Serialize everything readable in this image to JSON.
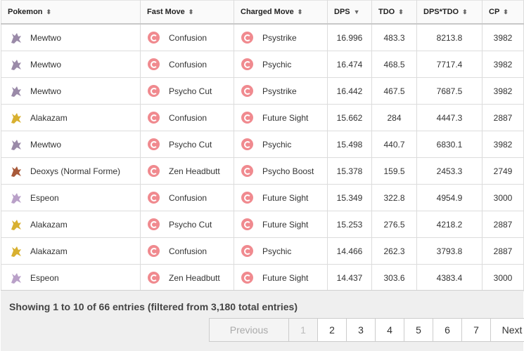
{
  "headers": {
    "pokemon": "Pokemon",
    "fast_move": "Fast Move",
    "charged_move": "Charged Move",
    "dps": "DPS",
    "tdo": "TDO",
    "dps_tdo": "DPS*TDO",
    "cp": "CP"
  },
  "sort_icons": {
    "unsorted": "⬍",
    "desc": "▼"
  },
  "rows": [
    {
      "pokemon": "Mewtwo",
      "fast": "Confusion",
      "charged": "Psystrike",
      "dps": "16.996",
      "tdo": "483.3",
      "dpstdo": "8213.8",
      "cp": "3982"
    },
    {
      "pokemon": "Mewtwo",
      "fast": "Confusion",
      "charged": "Psychic",
      "dps": "16.474",
      "tdo": "468.5",
      "dpstdo": "7717.4",
      "cp": "3982"
    },
    {
      "pokemon": "Mewtwo",
      "fast": "Psycho Cut",
      "charged": "Psystrike",
      "dps": "16.442",
      "tdo": "467.5",
      "dpstdo": "7687.5",
      "cp": "3982"
    },
    {
      "pokemon": "Alakazam",
      "fast": "Confusion",
      "charged": "Future Sight",
      "dps": "15.662",
      "tdo": "284",
      "dpstdo": "4447.3",
      "cp": "2887"
    },
    {
      "pokemon": "Mewtwo",
      "fast": "Psycho Cut",
      "charged": "Psychic",
      "dps": "15.498",
      "tdo": "440.7",
      "dpstdo": "6830.1",
      "cp": "3982"
    },
    {
      "pokemon": "Deoxys (Normal Forme)",
      "fast": "Zen Headbutt",
      "charged": "Psycho Boost",
      "dps": "15.378",
      "tdo": "159.5",
      "dpstdo": "2453.3",
      "cp": "2749"
    },
    {
      "pokemon": "Espeon",
      "fast": "Confusion",
      "charged": "Future Sight",
      "dps": "15.349",
      "tdo": "322.8",
      "dpstdo": "4954.9",
      "cp": "3000"
    },
    {
      "pokemon": "Alakazam",
      "fast": "Psycho Cut",
      "charged": "Future Sight",
      "dps": "15.253",
      "tdo": "276.5",
      "dpstdo": "4218.2",
      "cp": "2887"
    },
    {
      "pokemon": "Alakazam",
      "fast": "Confusion",
      "charged": "Psychic",
      "dps": "14.466",
      "tdo": "262.3",
      "dpstdo": "3793.8",
      "cp": "2887"
    },
    {
      "pokemon": "Espeon",
      "fast": "Zen Headbutt",
      "charged": "Future Sight",
      "dps": "14.437",
      "tdo": "303.6",
      "dpstdo": "4383.4",
      "cp": "3000"
    }
  ],
  "sprite_colors": {
    "Mewtwo": "#9a8aa8",
    "Alakazam": "#d8b030",
    "Deoxys (Normal Forme)": "#a85a3a",
    "Espeon": "#b9a0c8"
  },
  "type_color": "#f08a8f",
  "footer": {
    "info": "Showing 1 to 10 of 66 entries (filtered from 3,180 total entries)",
    "previous": "Previous",
    "pages": [
      "1",
      "2",
      "3",
      "4",
      "5",
      "6",
      "7"
    ],
    "next": "Next"
  }
}
